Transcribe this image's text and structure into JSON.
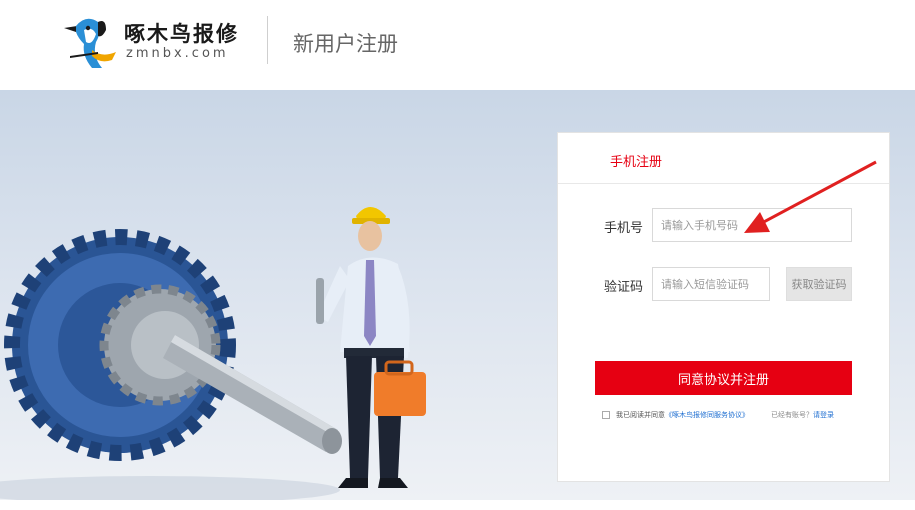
{
  "header": {
    "brand_name": "啄木鸟报修",
    "brand_domain": "zmnbx.com",
    "page_title": "新用户注册"
  },
  "form": {
    "tab_label": "手机注册",
    "phone_label": "手机号",
    "phone_placeholder": "请输入手机号码",
    "phone_value": "",
    "code_label": "验证码",
    "code_placeholder": "请输入短信验证码",
    "code_value": "",
    "get_code_label": "获取验证码",
    "submit_label": "同意协议并注册",
    "agree_prefix": "我已阅读并同意",
    "agree_link": "《啄木鸟报修同服务协议》",
    "login_prompt": "已经有账号？",
    "login_link": "请登录"
  },
  "colors": {
    "accent": "#e60012",
    "link": "#1f6fd1",
    "gear_blue": "#2f5a9e"
  },
  "icons": [
    "woodpecker-logo",
    "arrow-annotation"
  ]
}
